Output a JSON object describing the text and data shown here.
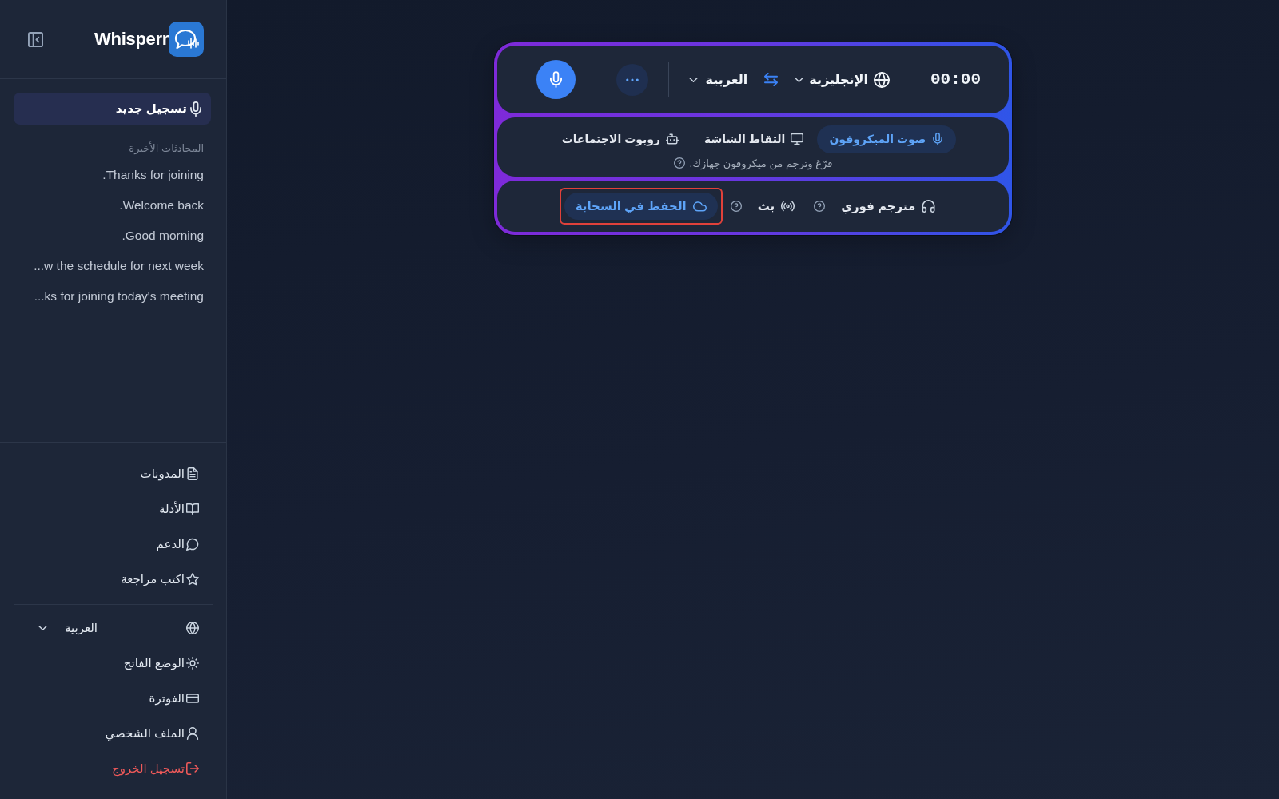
{
  "sidebar": {
    "logo_text": "Whisperr",
    "new_recording": "تسجيل جديد",
    "recent_heading": "المحادثات الأخيرة",
    "recent_conversations": [
      ".Thanks for joining",
      ".Welcome back",
      ".Good morning",
      "...w the schedule for next week",
      "...ks for joining today's meeting"
    ],
    "nav_links": [
      "المدونات",
      "الأدلة",
      "الدعم",
      "اكتب مراجعة"
    ],
    "language": "العربية",
    "account_links": [
      {
        "label": "الوضع الفاتح",
        "kind": "normal"
      },
      {
        "label": "الفوترة",
        "kind": "normal"
      },
      {
        "label": "الملف الشخصي",
        "kind": "normal"
      },
      {
        "label": "تسجيل الخروج",
        "kind": "danger"
      }
    ]
  },
  "recorder": {
    "timer": "00:00",
    "source_language": "الإنجليزية",
    "target_language": "العربية",
    "source_tabs": [
      {
        "label": "صوت الميكروفون",
        "selected": true
      },
      {
        "label": "التقاط الشاشة",
        "selected": false
      },
      {
        "label": "روبوت الاجتماعات",
        "selected": false
      }
    ],
    "source_hint": "فرّغ وترجم من ميكروفون جهازك.",
    "options": [
      {
        "label": "مترجم فوري",
        "on": false,
        "help_icon": true,
        "highlighted": false
      },
      {
        "label": "بث",
        "on": false,
        "help_icon": true,
        "highlighted": false
      },
      {
        "label": "الحفظ في السحابة",
        "on": true,
        "help_icon": false,
        "highlighted": true
      }
    ]
  }
}
